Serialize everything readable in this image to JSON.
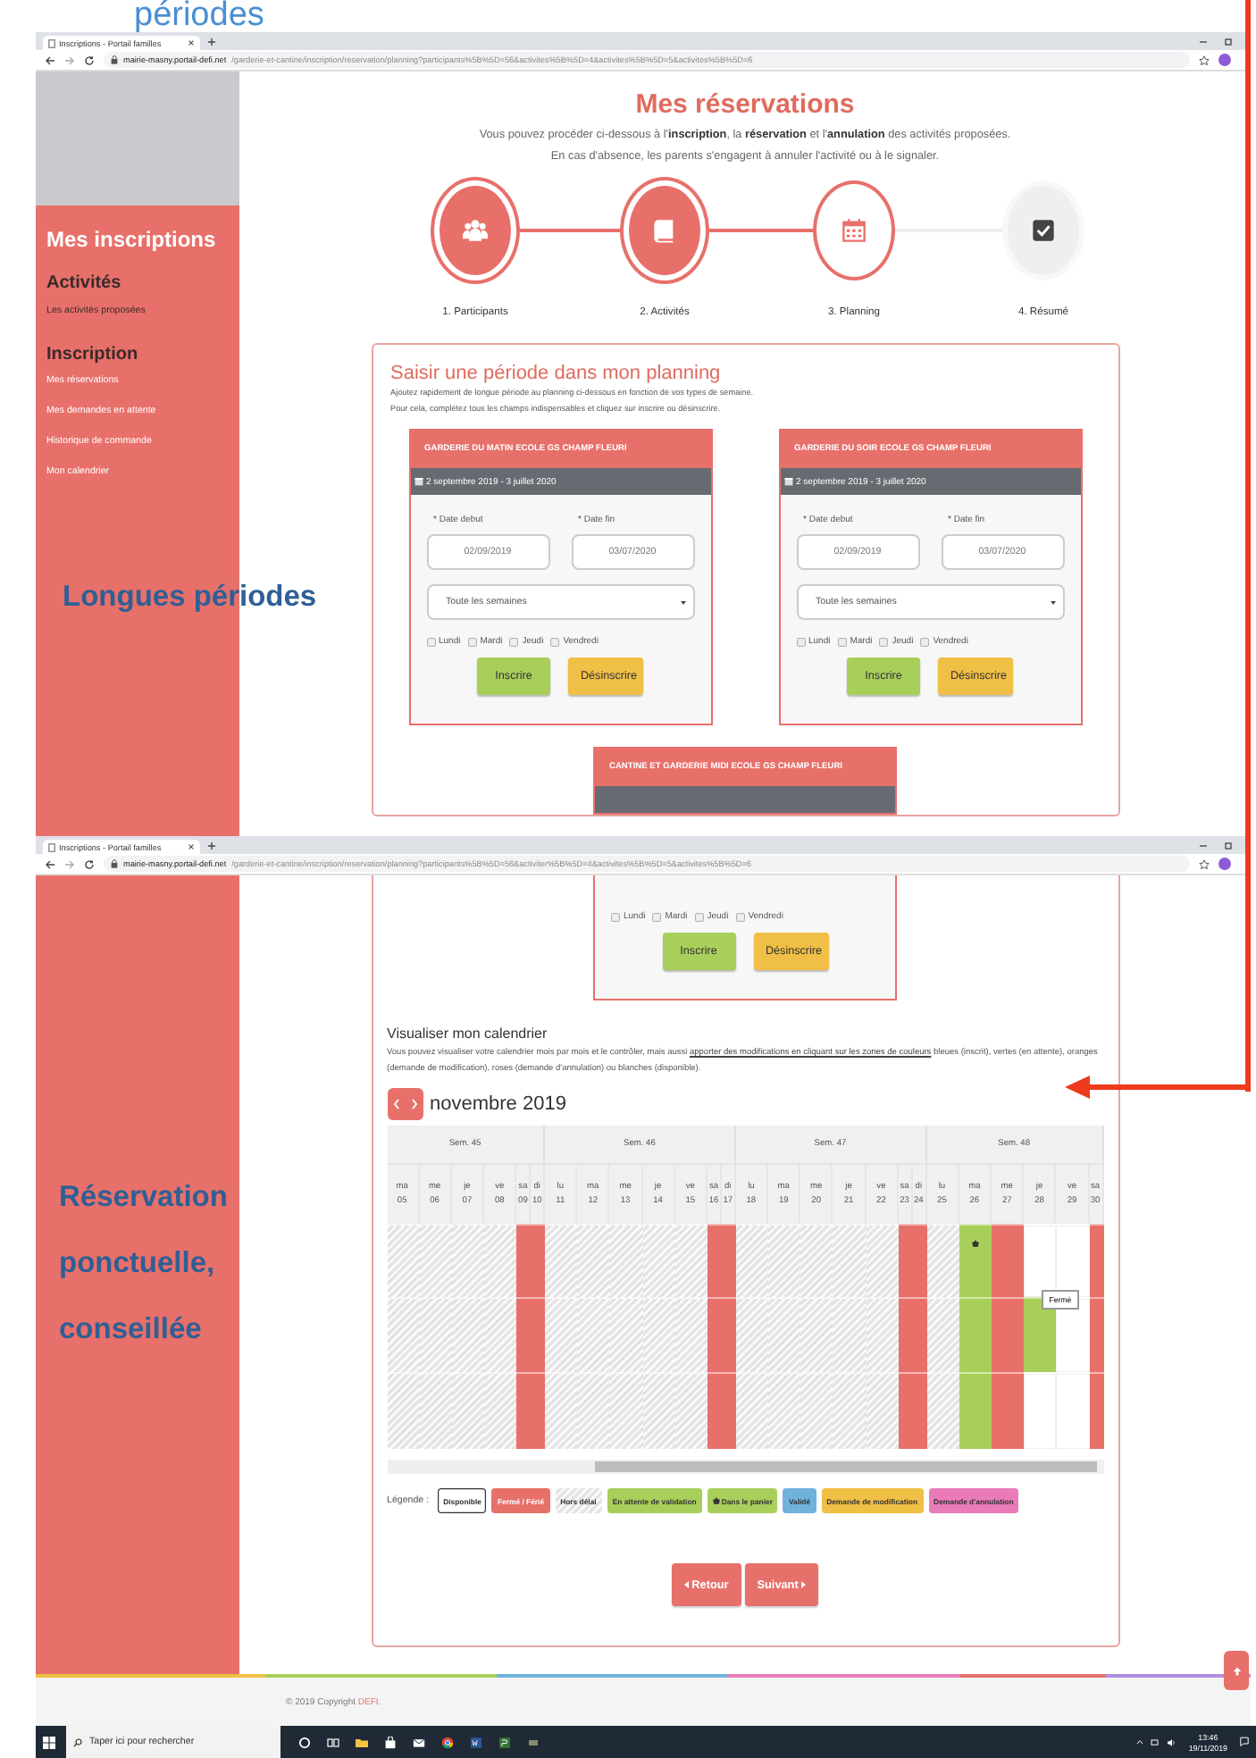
{
  "annotations": [
    {
      "text": "périodes",
      "kind": "caption"
    },
    {
      "text": "Longues périodes",
      "kind": "callout"
    },
    {
      "text": "Réservation ponctuelle, conseillée",
      "kind": "callout"
    }
  ],
  "windows": [
    {
      "tab_title": "Inscriptions - Portail familles",
      "url": "**mairie-masny.portail-defi.net**/garderie-et-cantine/inscription/reservation/planning?participants%5B%5D=56&activites%5B%5D=4&activites%5B%5D=5&activites%5B%5D=6"
    },
    {
      "tab_title": "Inscriptions - Portail familles",
      "url": "**mairie-masny.portail-defi.net**/garderie-et-cantine/inscription/reservation/planning?participants%5B%5D=56&activiter%5B%5D=4&activites%5B%5D=5&activites%5B%5D=6"
    }
  ],
  "sidebar": {
    "title": "Mes inscriptions",
    "sections": [
      {
        "heading": "Activités",
        "items": [
          "Les activités proposées"
        ]
      },
      {
        "heading": "Inscription",
        "items": [
          "Mes réservations",
          "Mes demandes en attente",
          "Historique de commande",
          "Mon calendrier"
        ]
      }
    ]
  },
  "header": {
    "title": "Mes réservations",
    "intro": [
      "Vous pouvez procéder ci-dessous à l'**inscription**, la **réservation** et l'**annulation** des activités proposées.",
      "En cas d'absence, les parents s'engagent à annuler l'activité ou à le signaler."
    ]
  },
  "steps": [
    {
      "label": "1. Participants",
      "kind": "people",
      "done": true,
      "selected": false
    },
    {
      "label": "2. Activités",
      "kind": "book",
      "done": true,
      "selected": false
    },
    {
      "label": "3. Planning",
      "kind": "calendar",
      "done": false,
      "selected": true
    },
    {
      "label": "4. Résumé",
      "kind": "check",
      "done": false,
      "selected": false
    }
  ],
  "period": {
    "title": "Saisir une période dans mon planning",
    "lines": [
      "Ajoutez rapidement de longue période au planning ci-dessous en fonction de vos types de semaine.",
      "Pour cela, complétez tous les champs indispensables et cliquez sur inscrire ou désinscrire."
    ],
    "cards": [
      {
        "title": "GARDERIE DU MATIN ECOLE GS CHAMP FLEURI",
        "dates": "2 septembre 2019 - 3 juillet 2020",
        "start_label": "* Date debut",
        "start": "02/09/2019",
        "end_label": "* Date fin",
        "end": "03/07/2020",
        "weeks": "Toute les semaines",
        "days": [
          {
            "label": "Lundi",
            "checked": false
          },
          {
            "label": "Mardi",
            "checked": false
          },
          {
            "label": "Jeudi",
            "checked": false
          },
          {
            "label": "Vendredi",
            "checked": false
          }
        ],
        "buttons": [
          {
            "label": "Inscrire",
            "kind": "register"
          },
          {
            "label": "Désinscrire",
            "kind": "unregister"
          }
        ]
      },
      {
        "title": "GARDERIE DU SOIR ECOLE GS CHAMP FLEURI",
        "dates": "2 septembre 2019 - 3 juillet 2020",
        "start_label": "* Date debut",
        "start": "02/09/2019",
        "end_label": "* Date fin",
        "end": "03/07/2020",
        "weeks": "Toute les semaines",
        "days": [
          {
            "label": "Lundi",
            "checked": false
          },
          {
            "label": "Mardi",
            "checked": false
          },
          {
            "label": "Jeudi",
            "checked": false
          },
          {
            "label": "Vendredi",
            "checked": false
          }
        ],
        "buttons": [
          {
            "label": "Inscrire",
            "kind": "register"
          },
          {
            "label": "Désinscrire",
            "kind": "unregister"
          }
        ]
      },
      {
        "title": "CANTINE ET GARDERIE MIDI ECOLE GS CHAMP FLEURI"
      }
    ]
  },
  "period_continued": {
    "days": [
      {
        "label": "Lundi",
        "checked": false
      },
      {
        "label": "Mardi",
        "checked": false
      },
      {
        "label": "Jeudi",
        "checked": false
      },
      {
        "label": "Vendredi",
        "checked": false
      }
    ],
    "buttons": [
      {
        "label": "Inscrire",
        "kind": "register"
      },
      {
        "label": "Désinscrire",
        "kind": "unregister"
      }
    ]
  },
  "calendar": {
    "title": "Visualiser mon calendrier",
    "text_before": "Vous pouvez visualiser votre calendrier mois par mois et le contrôler, mais aussi ",
    "link": "apporter des modifications en cliquant sur les zones de couleurs",
    "text_after": " bleues (inscrit), vertes (en attente), oranges (demande de modification), roses (demande d'annulation) ou blanches (disponible).",
    "month": "novembre 2019",
    "weeks": [
      {
        "label": "Sem. 45",
        "days": [
          {
            "dow": "ma",
            "num": "05",
            "kind": "weekday",
            "cells": [
              {
                "kind": "hors"
              },
              {
                "kind": "hors"
              },
              {
                "kind": "hors"
              }
            ]
          },
          {
            "dow": "me",
            "num": "06",
            "kind": "weekday",
            "cells": [
              {
                "kind": "hors"
              },
              {
                "kind": "hors"
              },
              {
                "kind": "hors"
              }
            ]
          },
          {
            "dow": "je",
            "num": "07",
            "kind": "weekday",
            "cells": [
              {
                "kind": "hors"
              },
              {
                "kind": "hors"
              },
              {
                "kind": "hors"
              }
            ]
          },
          {
            "dow": "ve",
            "num": "08",
            "kind": "weekday",
            "cells": [
              {
                "kind": "hors"
              },
              {
                "kind": "hors"
              },
              {
                "kind": "hors"
              }
            ]
          },
          {
            "dow": "sa",
            "num": "09",
            "kind": "weekend",
            "cells": [
              {
                "kind": "ferme"
              },
              {
                "kind": "ferme"
              },
              {
                "kind": "ferme"
              }
            ]
          },
          {
            "dow": "di",
            "num": "10",
            "kind": "weekend",
            "cells": [
              {
                "kind": "ferme"
              },
              {
                "kind": "ferme"
              },
              {
                "kind": "ferme"
              }
            ]
          }
        ]
      },
      {
        "label": "Sem. 46",
        "days": [
          {
            "dow": "lu",
            "num": "11",
            "kind": "weekday",
            "cells": [
              {
                "kind": "hors"
              },
              {
                "kind": "hors"
              },
              {
                "kind": "hors"
              }
            ]
          },
          {
            "dow": "ma",
            "num": "12",
            "kind": "weekday",
            "cells": [
              {
                "kind": "hors"
              },
              {
                "kind": "hors"
              },
              {
                "kind": "hors"
              }
            ]
          },
          {
            "dow": "me",
            "num": "13",
            "kind": "weekday",
            "cells": [
              {
                "kind": "hors"
              },
              {
                "kind": "hors"
              },
              {
                "kind": "hors"
              }
            ]
          },
          {
            "dow": "je",
            "num": "14",
            "kind": "weekday",
            "cells": [
              {
                "kind": "hors"
              },
              {
                "kind": "hors"
              },
              {
                "kind": "hors"
              }
            ]
          },
          {
            "dow": "ve",
            "num": "15",
            "kind": "weekday",
            "cells": [
              {
                "kind": "hors"
              },
              {
                "kind": "hors"
              },
              {
                "kind": "hors"
              }
            ]
          },
          {
            "dow": "sa",
            "num": "16",
            "kind": "weekend",
            "cells": [
              {
                "kind": "ferme"
              },
              {
                "kind": "ferme"
              },
              {
                "kind": "ferme"
              }
            ]
          },
          {
            "dow": "di",
            "num": "17",
            "kind": "weekend",
            "cells": [
              {
                "kind": "ferme"
              },
              {
                "kind": "ferme"
              },
              {
                "kind": "ferme"
              }
            ]
          }
        ]
      },
      {
        "label": "Sem. 47",
        "days": [
          {
            "dow": "lu",
            "num": "18",
            "kind": "weekday",
            "cells": [
              {
                "kind": "hors"
              },
              {
                "kind": "hors"
              },
              {
                "kind": "hors"
              }
            ]
          },
          {
            "dow": "ma",
            "num": "19",
            "kind": "weekday",
            "cells": [
              {
                "kind": "hors"
              },
              {
                "kind": "hors"
              },
              {
                "kind": "hors"
              }
            ]
          },
          {
            "dow": "me",
            "num": "20",
            "kind": "weekday",
            "cells": [
              {
                "kind": "hors"
              },
              {
                "kind": "hors"
              },
              {
                "kind": "hors"
              }
            ]
          },
          {
            "dow": "je",
            "num": "21",
            "kind": "weekday",
            "cells": [
              {
                "kind": "hors"
              },
              {
                "kind": "hors"
              },
              {
                "kind": "hors"
              }
            ]
          },
          {
            "dow": "ve",
            "num": "22",
            "kind": "weekday",
            "cells": [
              {
                "kind": "hors"
              },
              {
                "kind": "hors"
              },
              {
                "kind": "hors"
              }
            ]
          },
          {
            "dow": "sa",
            "num": "23",
            "kind": "weekend",
            "cells": [
              {
                "kind": "ferme"
              },
              {
                "kind": "ferme"
              },
              {
                "kind": "ferme"
              }
            ]
          },
          {
            "dow": "di",
            "num": "24",
            "kind": "weekend",
            "cells": [
              {
                "kind": "ferme"
              },
              {
                "kind": "ferme"
              },
              {
                "kind": "ferme"
              }
            ]
          }
        ]
      },
      {
        "label": "Sem. 48",
        "days": [
          {
            "dow": "lu",
            "num": "25",
            "kind": "weekday",
            "cells": [
              {
                "kind": "hors"
              },
              {
                "kind": "hors"
              },
              {
                "kind": "hors"
              }
            ]
          },
          {
            "dow": "ma",
            "num": "26",
            "kind": "weekday",
            "cells": [
              {
                "kind": "panier"
              },
              {
                "kind": "attente"
              },
              {
                "kind": "attente"
              }
            ]
          },
          {
            "dow": "me",
            "num": "27",
            "kind": "weekday",
            "cells": [
              {
                "kind": "ferme"
              },
              {
                "kind": "ferme"
              },
              {
                "kind": "ferme"
              }
            ]
          },
          {
            "dow": "je",
            "num": "28",
            "kind": "weekday",
            "cells": [
              {
                "kind": "dispo"
              },
              {
                "kind": "attente"
              },
              {
                "kind": "dispo"
              }
            ],
            "tooltip": "Fermé"
          },
          {
            "dow": "ve",
            "num": "29",
            "kind": "weekday",
            "cells": [
              {
                "kind": "dispo"
              },
              {
                "kind": "dispo"
              },
              {
                "kind": "dispo"
              }
            ]
          },
          {
            "dow": "sa",
            "num": "30",
            "kind": "weekend",
            "cells": [
              {
                "kind": "ferme"
              },
              {
                "kind": "ferme"
              },
              {
                "kind": "ferme"
              }
            ]
          }
        ]
      }
    ],
    "legend": {
      "label": "Légende :",
      "items": [
        {
          "label": "Disponible",
          "kind": "dispo",
          "color": "#ffffff"
        },
        {
          "label": "Fermé / Férié",
          "kind": "ferme",
          "color": "#e8706a"
        },
        {
          "label": "Hors délai",
          "kind": "hors",
          "color": "#e4e4e4"
        },
        {
          "label": "En attente de validation",
          "kind": "attente",
          "color": "#a8cf5a"
        },
        {
          "label": "Dans le panier",
          "kind": "panier",
          "color": "#a8cf5a"
        },
        {
          "label": "Validé",
          "kind": "valide",
          "color": "#6fb3dd"
        },
        {
          "label": "Demande de modification",
          "kind": "modification",
          "color": "#f0bf45"
        },
        {
          "label": "Demande d'annulation",
          "kind": "annulation",
          "color": "#e97bb8"
        }
      ]
    }
  },
  "navigation": [
    {
      "label": "Retour",
      "kind": "back"
    },
    {
      "label": "Suivant",
      "kind": "next"
    }
  ],
  "footer": {
    "copyright": "© 2019 Copyright",
    "brand": "DEFI."
  },
  "taskbar": {
    "search_placeholder": "Taper ici pour rechercher",
    "time": "13:46",
    "date": "19/11/2019"
  }
}
